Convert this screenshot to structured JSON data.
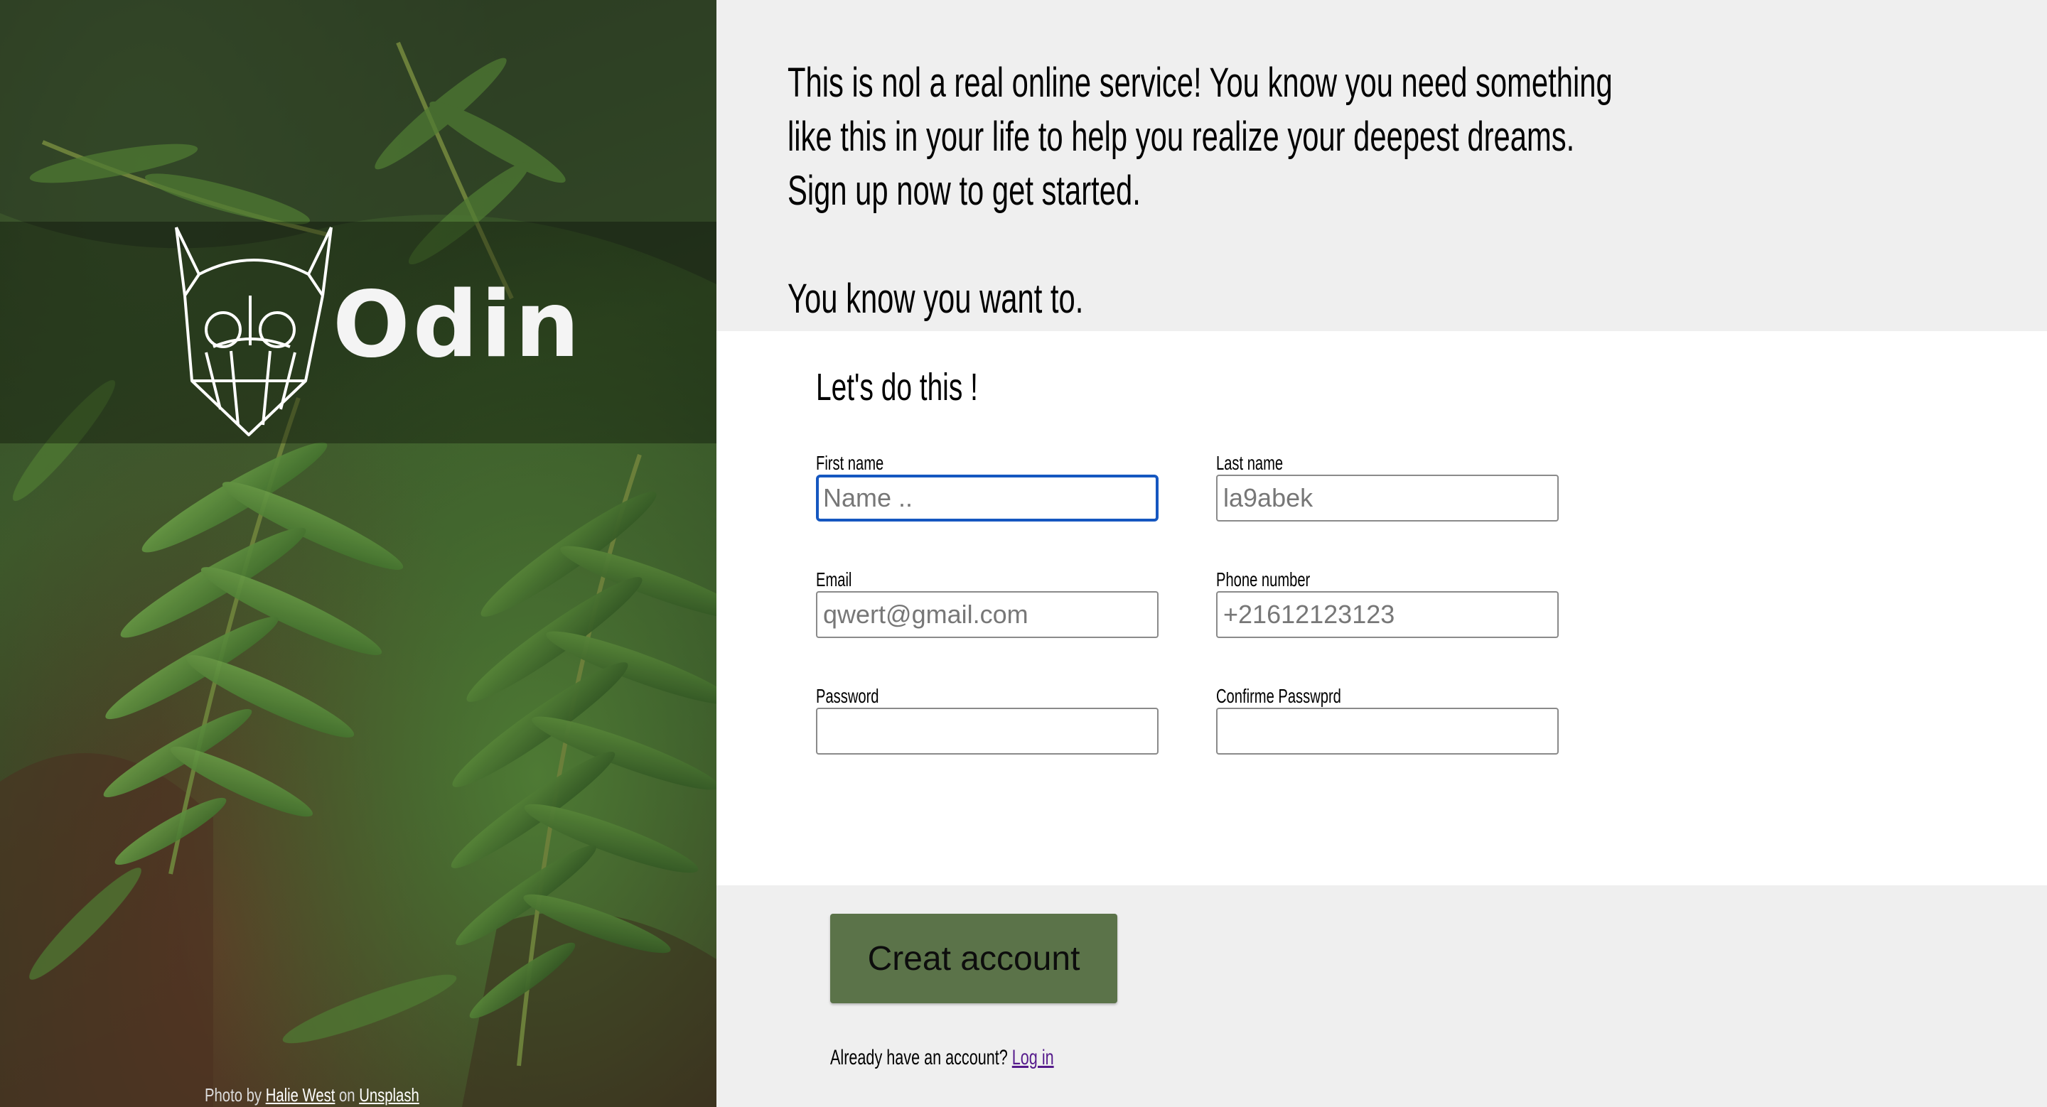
{
  "sidebar": {
    "brand_name": "Odin",
    "credit": {
      "prefix": "Photo by ",
      "author": "Halie West",
      "middle": " on ",
      "site": "Unsplash"
    }
  },
  "intro": {
    "lines": [
      "This is nol a real online service! You know you need something",
      "like this in your life to help you realize your deepest dreams.",
      "Sign up now to get started.",
      "You know you want to."
    ]
  },
  "form": {
    "title": "Let's do this !",
    "fields": {
      "first_name": {
        "label": "First name",
        "placeholder": "Name .."
      },
      "last_name": {
        "label": "Last name",
        "placeholder": "la9abek"
      },
      "email": {
        "label": "Email",
        "placeholder": "qwert@gmail.com"
      },
      "phone": {
        "label": "Phone number",
        "placeholder": "+21612123123"
      },
      "password": {
        "label": "Password",
        "placeholder": ""
      },
      "confirm_password": {
        "label": "Confirme Passwprd",
        "placeholder": ""
      }
    }
  },
  "footer": {
    "button_label": "Creat account",
    "login_prompt": "Already have an account? ",
    "login_link": "Log in"
  },
  "colors": {
    "button": "#5b7349",
    "focus_border": "#1557c0",
    "link": "#551a8b",
    "panel_bg": "#efefef",
    "form_bg": "#ffffff"
  },
  "icons": {
    "logo": "viking-helmet-icon"
  }
}
